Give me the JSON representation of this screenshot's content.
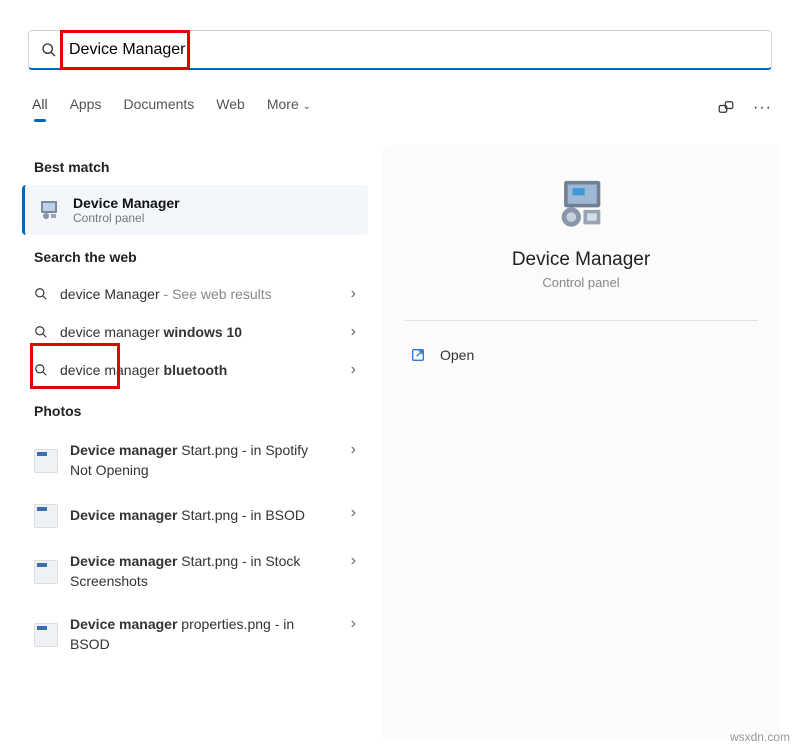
{
  "search": {
    "query": "Device Manager"
  },
  "tabs": {
    "items": [
      "All",
      "Apps",
      "Documents",
      "Web",
      "More"
    ],
    "active_index": 0
  },
  "sections": {
    "best_match": "Best match",
    "search_web": "Search the web",
    "photos": "Photos"
  },
  "best_match_item": {
    "title": "Device Manager",
    "subtitle": "Control panel"
  },
  "web_results": [
    {
      "prefix": "device Manager",
      "bold": "",
      "suffix": " - See web results"
    },
    {
      "prefix": "device manager ",
      "bold": "windows 10",
      "suffix": ""
    },
    {
      "prefix": "device manager ",
      "bold": "bluetooth",
      "suffix": ""
    }
  ],
  "photos_results": [
    {
      "bold": "Device manager",
      "rest": " Start.png - in Spotify Not Opening"
    },
    {
      "bold": "Device manager",
      "rest": " Start.png - in BSOD"
    },
    {
      "bold": "Device manager",
      "rest": " Start.png - in Stock Screenshots"
    },
    {
      "bold": "Device manager",
      "rest": " properties.png - in BSOD"
    }
  ],
  "preview": {
    "title": "Device Manager",
    "subtitle": "Control panel",
    "open_label": "Open"
  },
  "watermark": "wsxdn.com"
}
